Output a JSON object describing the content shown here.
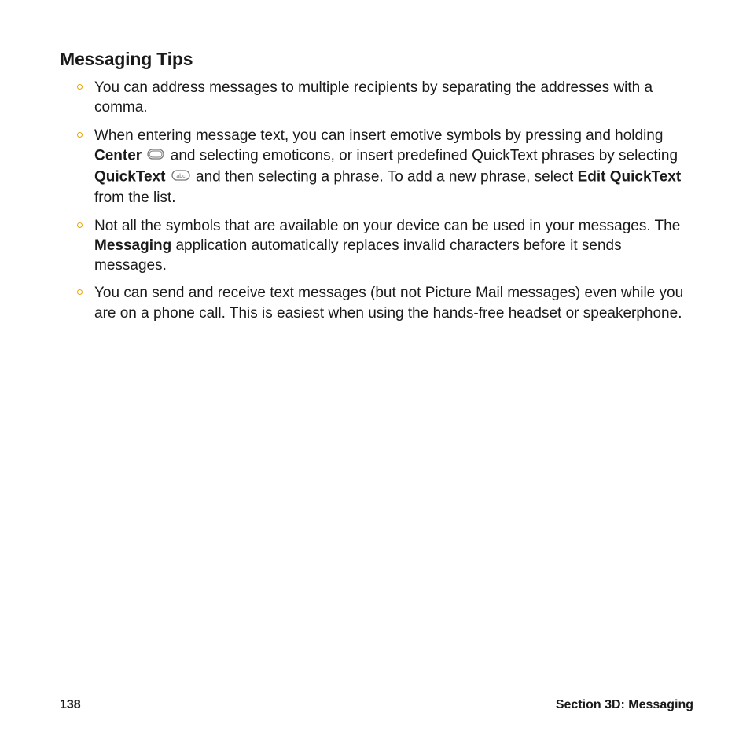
{
  "title": "Messaging Tips",
  "tips": {
    "item1": "You can address messages to multiple recipients by separating the addresses with a comma.",
    "item2": {
      "t1": "When entering message text, you can insert emotive symbols by pressing and holding ",
      "b1": "Center",
      "t2": " and selecting emoticons, or insert predefined QuickText phrases by selecting ",
      "b2": "QuickText",
      "t3": " and then selecting a phrase. To add a new phrase, select ",
      "b3": "Edit QuickText",
      "t4": " from the list."
    },
    "item3": {
      "t1": "Not all the symbols that are available on your device can be used in your messages. The ",
      "b1": "Messaging",
      "t2": " application automatically replaces invalid characters before it sends messages."
    },
    "item4": "You can send and receive text messages (but not Picture Mail messages) even while you are on a phone call. This is easiest when using the hands-free headset or speakerphone."
  },
  "footer": {
    "page": "138",
    "section": "Section 3D: Messaging"
  }
}
